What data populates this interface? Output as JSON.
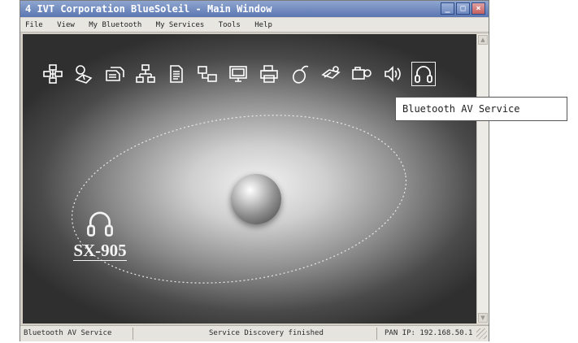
{
  "window": {
    "title": "4 IVT Corporation BlueSoleil - Main Window",
    "controls": {
      "minimize": "_",
      "maximize": "□",
      "close": "×"
    }
  },
  "menu": {
    "items": [
      "File",
      "View",
      "My Bluetooth",
      "My Services",
      "Tools",
      "Help"
    ]
  },
  "toolbar": {
    "icons": [
      "dial-up-networking-icon",
      "fax-icon",
      "file-transfer-icon",
      "lan-access-icon",
      "object-push-icon",
      "network-icon",
      "pim-sync-icon",
      "printer-icon",
      "mouse-icon",
      "serial-port-icon",
      "camera-icon",
      "audio-gateway-icon",
      "headset-icon"
    ],
    "active": "headset-icon",
    "tooltip": "Bluetooth AV Service"
  },
  "device": {
    "name": "SX-905",
    "icon": "headset-icon"
  },
  "status": {
    "left": "Bluetooth AV Service",
    "middle": "Service Discovery finished",
    "right": "PAN IP: 192.168.50.1"
  }
}
